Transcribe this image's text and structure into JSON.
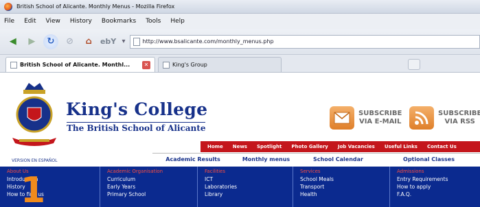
{
  "window": {
    "title": "British School of Alicante. Monthly Menus - Mozilla Firefox"
  },
  "menu": [
    "File",
    "Edit",
    "View",
    "History",
    "Bookmarks",
    "Tools",
    "Help"
  ],
  "toolbar": {
    "url": "http://www.bsalicante.com/monthly_menus.php",
    "ebay_label": "ebY"
  },
  "tabs": [
    {
      "label": "British School of Alicante. Monthl..."
    },
    {
      "label": "King's Group"
    }
  ],
  "site": {
    "name": "King's College",
    "subtitle": "The British School of Alicante",
    "language_link": "VERSION EN ESPAÑOL",
    "subscribe_email": [
      "SUBSCRIBE",
      "VIA E-MAIL"
    ],
    "subscribe_rss": [
      "SUBSCRIBE",
      "VIA RSS"
    ],
    "top_nav": [
      "Home",
      "News",
      "Spotlight",
      "Photo Gallery",
      "Job Vacancies",
      "Useful Links",
      "Contact Us"
    ],
    "sub_nav": [
      "Academic Results",
      "Monthly menus",
      "School Calendar",
      "Optional Classes"
    ],
    "columns": [
      {
        "heading": "About Us",
        "items": [
          "Introduction",
          "History",
          "How to find us"
        ]
      },
      {
        "heading": "Academic Organisation",
        "items": [
          "Curriculum",
          "Early Years",
          "Primary School"
        ]
      },
      {
        "heading": "Facilities",
        "items": [
          "ICT",
          "Laboratories",
          "Library"
        ]
      },
      {
        "heading": "Services",
        "items": [
          "School Meals",
          "Transport",
          "Health"
        ]
      },
      {
        "heading": "Admissions",
        "items": [
          "Entry Requirements",
          "How to apply",
          "F.A.Q."
        ]
      }
    ]
  },
  "overlay": {
    "number": "1",
    "color": "#f08a1c"
  },
  "colors": {
    "brand_blue": "#0b2a8f",
    "nav_red": "#c4161c"
  }
}
